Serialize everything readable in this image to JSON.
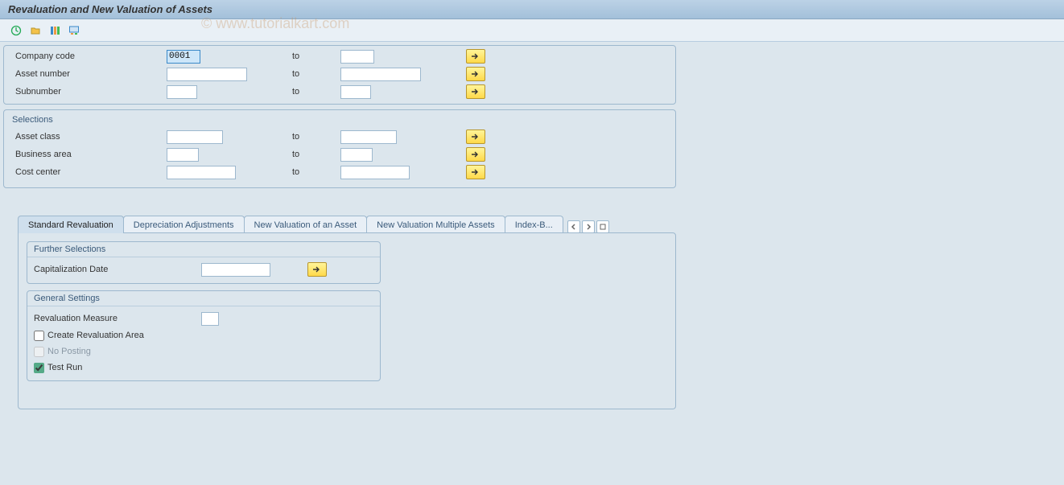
{
  "title": "Revaluation and New Valuation of Assets",
  "watermark": "© www.tutorialkart.com",
  "toolbar": {
    "execute": "execute-icon",
    "variant": "get-variant-icon",
    "select_all": "selection-options-icon",
    "dynamic": "dynamic-selections-icon"
  },
  "top": {
    "company_code": {
      "label": "Company code",
      "from": "0001",
      "to": ""
    },
    "asset_number": {
      "label": "Asset number",
      "from": "",
      "to": ""
    },
    "subnumber": {
      "label": "Subnumber",
      "from": "",
      "to": ""
    },
    "to_label": "to"
  },
  "selections": {
    "title": "Selections",
    "asset_class": {
      "label": "Asset class",
      "from": "",
      "to": ""
    },
    "business_area": {
      "label": "Business area",
      "from": "",
      "to": ""
    },
    "cost_center": {
      "label": "Cost center",
      "from": "",
      "to": ""
    },
    "to_label": "to"
  },
  "tabs": {
    "items": [
      {
        "label": "Standard Revaluation"
      },
      {
        "label": "Depreciation Adjustments"
      },
      {
        "label": "New Valuation of an Asset"
      },
      {
        "label": "New Valuation Multiple Assets"
      },
      {
        "label": "Index-B..."
      }
    ]
  },
  "further": {
    "title": "Further Selections",
    "cap_date": {
      "label": "Capitalization Date",
      "value": ""
    }
  },
  "general": {
    "title": "General Settings",
    "revaluation_measure": {
      "label": "Revaluation Measure",
      "value": ""
    },
    "create_area": {
      "label": "Create Revaluation Area",
      "checked": false
    },
    "no_posting": {
      "label": "No Posting",
      "checked": false,
      "disabled": true
    },
    "test_run": {
      "label": "Test Run",
      "checked": true
    }
  }
}
